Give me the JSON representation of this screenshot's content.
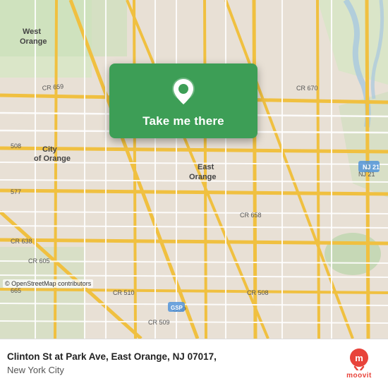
{
  "map": {
    "background_color": "#e8e0d8",
    "alt": "Map of East Orange, NJ area"
  },
  "action_card": {
    "button_label": "Take me there"
  },
  "bottom_bar": {
    "address_line1": "Clinton St at Park Ave, East Orange, NJ 07017,",
    "address_line2": "New York City",
    "moovit_label": "moovit"
  },
  "attribution": {
    "text": "© OpenStreetMap contributors"
  },
  "icons": {
    "pin": "location-pin-icon",
    "moovit": "moovit-logo-icon"
  }
}
